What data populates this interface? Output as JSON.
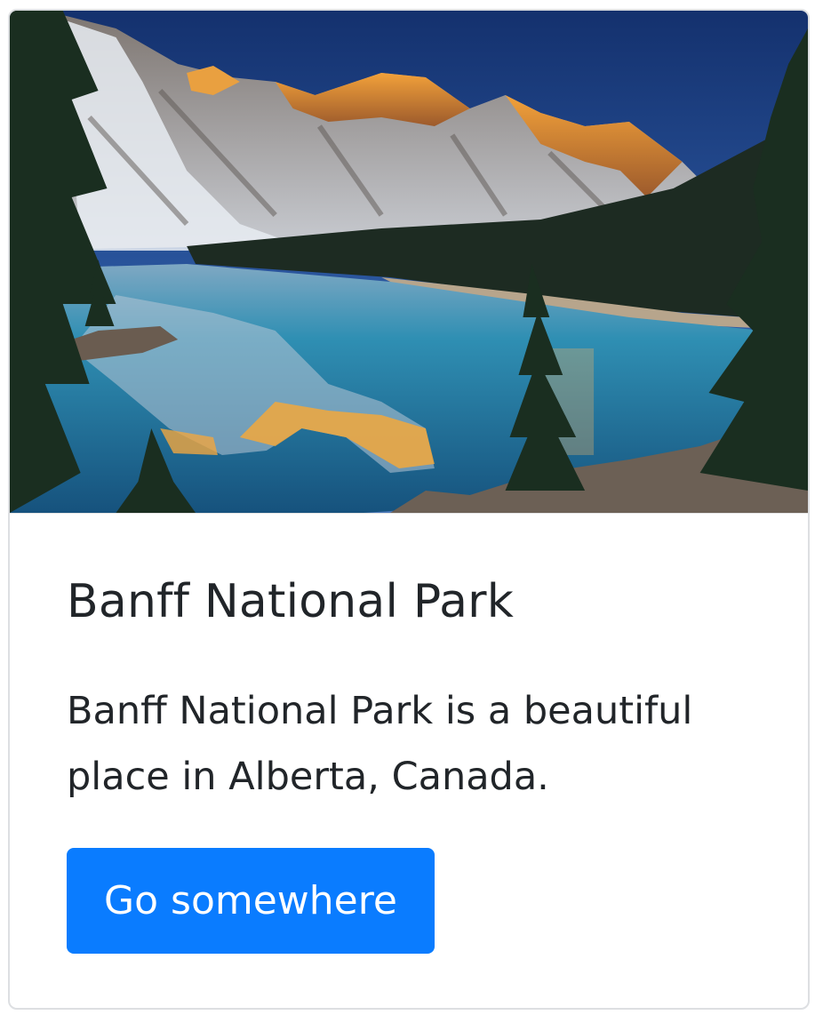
{
  "card": {
    "image_alt": "Moraine Lake reflecting snow-capped mountain peaks at sunrise",
    "title": "Banff National Park",
    "text": "Banff National Park is a beautiful place in Alberta, Canada.",
    "button_label": "Go somewhere",
    "button_color": "#0a7cff"
  }
}
